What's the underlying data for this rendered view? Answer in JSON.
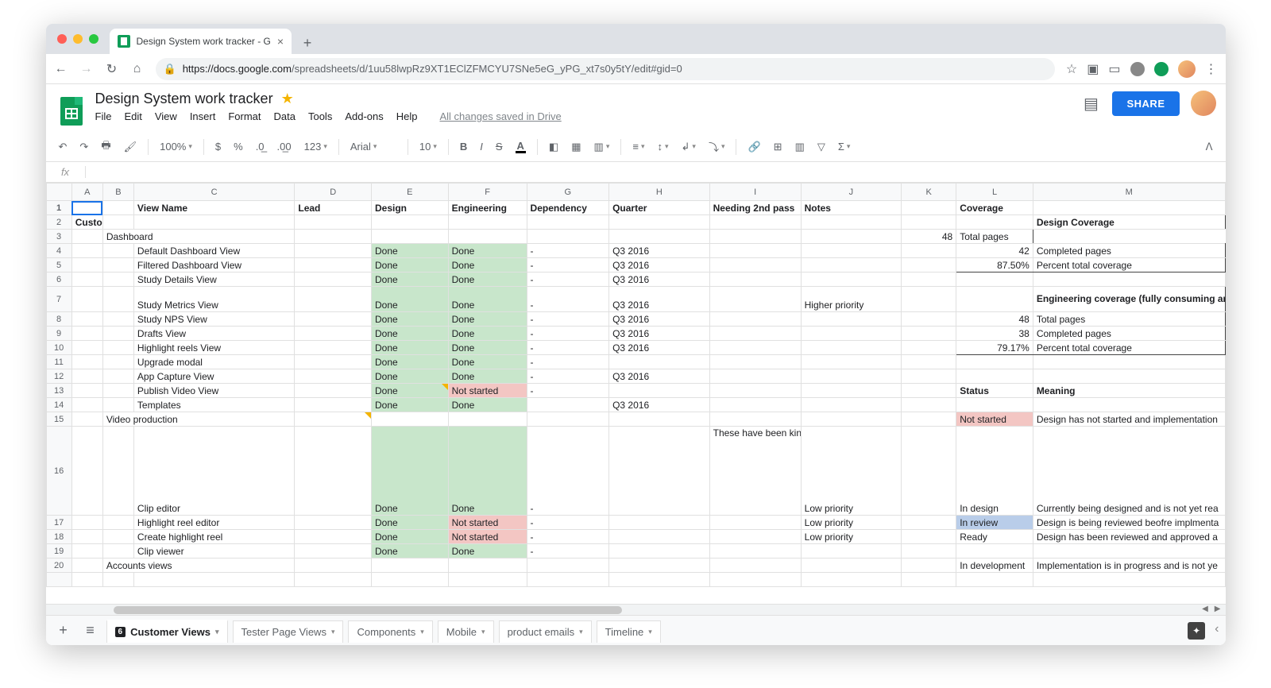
{
  "browser": {
    "tab_title": "Design System work tracker - G",
    "url_host": "https://docs.google.com",
    "url_path": "/spreadsheets/d/1uu58lwpRz9XT1EClZFMCYU7SNe5eG_yPG_xt7s0y5tY/edit#gid=0",
    "dot_colors": {
      "close": "#ff5f57",
      "min": "#febc2e",
      "max": "#28c840"
    }
  },
  "doc": {
    "title": "Design System work tracker",
    "menus": [
      "File",
      "Edit",
      "View",
      "Insert",
      "Format",
      "Data",
      "Tools",
      "Add-ons",
      "Help"
    ],
    "saved": "All changes saved in Drive",
    "share": "SHARE"
  },
  "toolbar": {
    "zoom": "100%",
    "currency": "$",
    "percent": "%",
    "dec_dec": ".0",
    "dec_inc": ".00",
    "num_format": "123",
    "font": "Arial",
    "size": "10"
  },
  "formula_label": "fx",
  "columns": [
    "",
    "A",
    "B",
    "C",
    "D",
    "E",
    "F",
    "G",
    "H",
    "I",
    "J",
    "K",
    "L",
    "M"
  ],
  "headers": {
    "view_name": "View Name",
    "lead": "Lead",
    "design": "Design",
    "engineering": "Engineering",
    "dependency": "Dependency",
    "quarter": "Quarter",
    "needing": "Needing 2nd pass",
    "notes": "Notes",
    "coverage": "Coverage"
  },
  "rows": {
    "customer": "Customer",
    "dashboard": "Dashboard",
    "items": [
      {
        "name": "Default Dashboard View",
        "design": "Done",
        "eng": "Done",
        "dep": "-",
        "q": "Q3 2016"
      },
      {
        "name": "Filtered Dashboard View",
        "design": "Done",
        "eng": "Done",
        "dep": "-",
        "q": "Q3 2016"
      },
      {
        "name": "Study Details View",
        "design": "Done",
        "eng": "Done",
        "dep": "-",
        "q": "Q3 2016"
      },
      {
        "name": "Study Metrics View",
        "design": "Done",
        "eng": "Done",
        "dep": "-",
        "q": "Q3 2016",
        "notes": "Higher priority"
      },
      {
        "name": "Study NPS View",
        "design": "Done",
        "eng": "Done",
        "dep": "-",
        "q": "Q3 2016"
      },
      {
        "name": "Drafts View",
        "design": "Done",
        "eng": "Done",
        "dep": "-",
        "q": "Q3 2016"
      },
      {
        "name": "Highlight reels View",
        "design": "Done",
        "eng": "Done",
        "dep": "-",
        "q": "Q3 2016"
      },
      {
        "name": "Upgrade modal",
        "design": "Done",
        "eng": "Done",
        "dep": "-"
      },
      {
        "name": "App Capture View",
        "design": "Done",
        "eng": "Done",
        "dep": "-",
        "q": "Q3 2016"
      },
      {
        "name": "Publish Video View",
        "design": "Done",
        "eng": "Not started",
        "dep": "-"
      },
      {
        "name": "Templates",
        "design": "Done",
        "eng": "Done",
        "dep": "",
        "q": "Q3 2016"
      }
    ],
    "video_prod": "Video production",
    "clip_editor": {
      "name": "Clip editor",
      "design": "Done",
      "eng": "Done",
      "dep": "-",
      "i": "These have been kinda started. (The pages are getting Proxima Nova + Stylesheet. The modals have been done. Just haven't added classes to reset.",
      "notes": "Low priority"
    },
    "hl_editor": {
      "name": "Highlight reel editor",
      "design": "Done",
      "eng": "Not started",
      "dep": "-",
      "notes": "Low priority"
    },
    "create_hl": {
      "name": "Create highlight reel",
      "design": "Done",
      "eng": "Not started",
      "dep": "-",
      "notes": "Low priority"
    },
    "clip_viewer": {
      "name": "Clip viewer",
      "design": "Done",
      "eng": "Done",
      "dep": "-"
    },
    "accounts": "Accounts views"
  },
  "coverage": {
    "design_title": "Design Coverage",
    "total_label": "Total pages",
    "completed_label": "Completed pages",
    "percent_label": "Percent total coverage",
    "design_total": "48",
    "design_completed": "42",
    "design_percent": "87.50%",
    "eng_title": "Engineering coverage (fully consuming and updated)",
    "eng_total": "48",
    "eng_completed": "38",
    "eng_percent": "79.17%"
  },
  "legend": {
    "status_hdr": "Status",
    "meaning_hdr": "Meaning",
    "not_started": "Not started",
    "not_started_m": "Design has not started and implementation",
    "in_design": "In design",
    "in_design_m": "Currently being designed and is not yet rea",
    "in_review": "In review",
    "in_review_m": "Design is being reviewed beofre implmenta",
    "ready": "Ready",
    "ready_m": "Design has been reviewed and approved a",
    "in_dev": "In development",
    "in_dev_m": "Implementation is in progress and is not ye"
  },
  "tabs": {
    "badge": "6",
    "list": [
      "Customer Views",
      "Tester Page Views",
      "Components",
      "Mobile",
      "product emails",
      "Timeline"
    ]
  }
}
